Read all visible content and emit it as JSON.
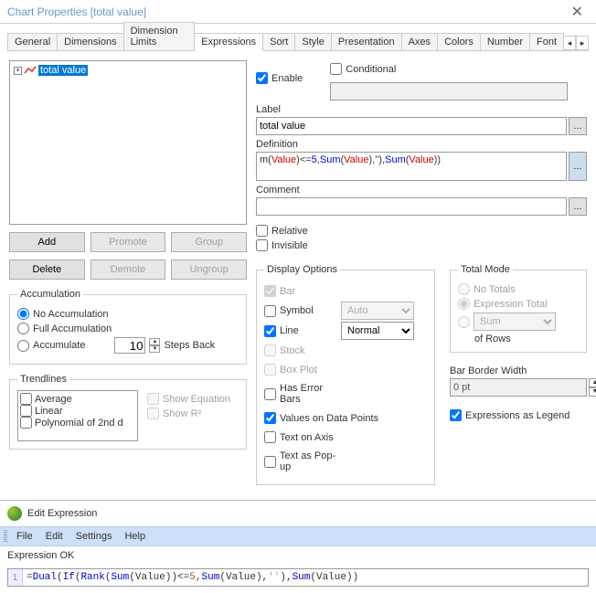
{
  "window_title": "Chart Properties [total value]",
  "tabs": [
    "General",
    "Dimensions",
    "Dimension Limits",
    "Expressions",
    "Sort",
    "Style",
    "Presentation",
    "Axes",
    "Colors",
    "Number",
    "Font"
  ],
  "active_tab": "Expressions",
  "tree_item": "total value",
  "buttons": {
    "add": "Add",
    "promote": "Promote",
    "group": "Group",
    "delete": "Delete",
    "demote": "Demote",
    "ungroup": "Ungroup"
  },
  "accum": {
    "legend": "Accumulation",
    "none": "No Accumulation",
    "full": "Full Accumulation",
    "acc": "Accumulate",
    "steps": "10",
    "steps_label": "Steps Back"
  },
  "trend": {
    "legend": "Trendlines",
    "items": [
      "Average",
      "Linear",
      "Polynomial of 2nd d"
    ],
    "show_eq": "Show Equation",
    "show_r2": "Show R²"
  },
  "topchecks": {
    "enable": "Enable",
    "conditional": "Conditional"
  },
  "label_lbl": "Label",
  "label_val": "total value",
  "def_lbl": "Definition",
  "def_parts": {
    "p1": "m(",
    "var": "Value",
    "p2": ")<=",
    "num": "5",
    "p3": ",",
    "fn": "Sum",
    "p4": "(",
    "p5": "),''),",
    "p6": "))"
  },
  "comment_lbl": "Comment",
  "relative": "Relative",
  "invisible": "Invisible",
  "disp": {
    "legend": "Display Options",
    "bar": "Bar",
    "symbol": "Symbol",
    "line": "Line",
    "stock": "Stock",
    "box": "Box Plot",
    "err": "Has Error Bars",
    "vals": "Values on Data Points",
    "txt_axis": "Text on Axis",
    "txt_pop": "Text as Pop-up",
    "auto": "Auto",
    "normal": "Normal"
  },
  "total": {
    "legend": "Total Mode",
    "none": "No Totals",
    "expr": "Expression Total",
    "sum": "Sum",
    "rows": "of Rows"
  },
  "bar_border": "Bar Border Width",
  "bar_border_val": "0 pt",
  "expr_legend": "Expressions as Legend",
  "editor": {
    "title": "Edit Expression",
    "menu": [
      "File",
      "Edit",
      "Settings",
      "Help"
    ],
    "status": "Expression OK",
    "line": "1",
    "code_parts": {
      "eq": "=",
      "dual": "Dual",
      "if": "If",
      "rank": "Rank",
      "sum": "Sum",
      "val": "Value",
      "le": "<=",
      "five": "5",
      "q": "''"
    }
  }
}
